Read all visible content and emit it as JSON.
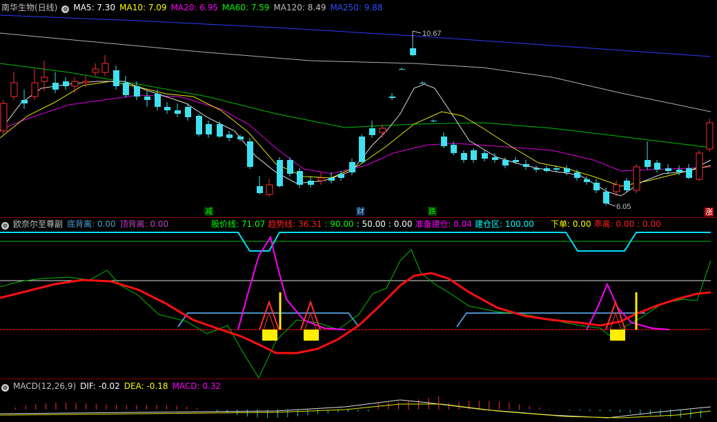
{
  "main": {
    "title": "南华生物(日线)",
    "ma": [
      {
        "label": "MA5: 7.30",
        "color": "#ffffff"
      },
      {
        "label": "MA10: 7.09",
        "color": "#ffff00"
      },
      {
        "label": "MA20: 6.95",
        "color": "#ff00ff"
      },
      {
        "label": "MA60: 7.59",
        "color": "#00ff00"
      },
      {
        "label": "MA120: 8.49",
        "color": "#c0c0c0"
      },
      {
        "label": "MA250: 9.88",
        "color": "#2f4fff"
      }
    ],
    "high_label": "10.67",
    "low_label": "6.05",
    "markers": [
      {
        "text": "减",
        "color": "#00ff00",
        "bg": "#003000"
      },
      {
        "text": "财",
        "color": "#8fd3ff",
        "bg": "#002040"
      },
      {
        "text": "跌",
        "color": "#00ff00",
        "bg": "#003000"
      },
      {
        "text": "涨",
        "color": "#ffffff",
        "bg": "#b00000"
      }
    ]
  },
  "indicator": {
    "title": "欧奈尔至尊副",
    "items": [
      {
        "label": "底背离: 0.00",
        "color": "#4aa3c8"
      },
      {
        "label": "顶背离: 0.00",
        "color": "#c040c0"
      }
    ],
    "items2": [
      {
        "label": "股价线: 71.07",
        "color": "#00ff00"
      },
      {
        "label": "趋势线: 36.31",
        "color": "#ff2020"
      },
      {
        "label": ": 90.00",
        "color": "#00ff00"
      },
      {
        "label": ": 50.00",
        "color": "#ffffff"
      },
      {
        "label": ": 0.00",
        "color": "#ffffff"
      },
      {
        "label": "准备建仓: 0.04",
        "color": "#ff00ff"
      },
      {
        "label": "建仓区: 100.00",
        "color": "#00ffff"
      }
    ],
    "items3": [
      {
        "label": "下单: 0.00",
        "color": "#ffff00"
      },
      {
        "label": "乖离: 0.00",
        "color": "#ff2020"
      },
      {
        "label": ": 0.00",
        "color": "#ff2020"
      }
    ]
  },
  "macd": {
    "title": "MACD(12,26,9)",
    "items": [
      {
        "label": "DIF: -0.02",
        "color": "#ffffff"
      },
      {
        "label": "DEA: -0.18",
        "color": "#ffff00"
      },
      {
        "label": "MACD: 0.32",
        "color": "#ff00ff"
      }
    ]
  }
}
